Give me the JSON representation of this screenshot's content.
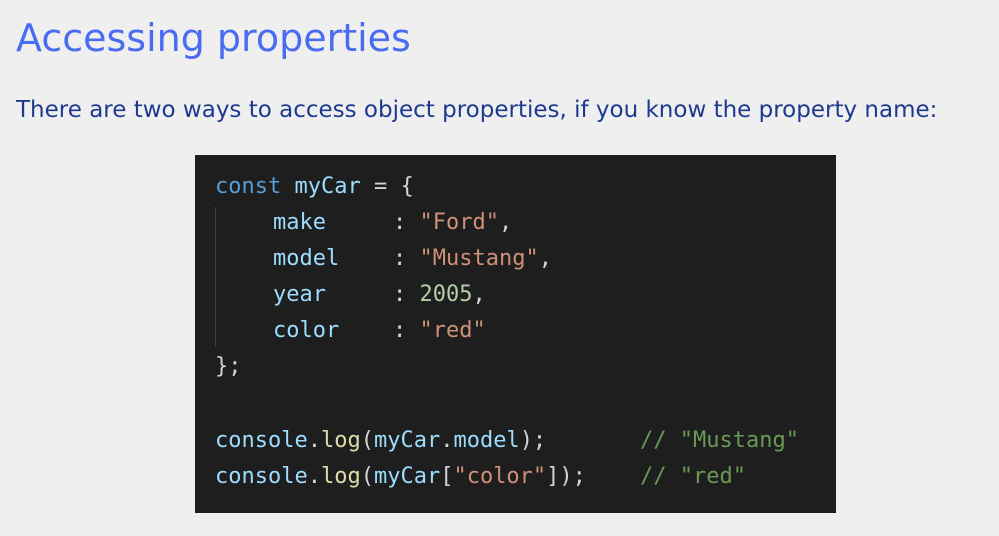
{
  "page": {
    "title": "Accessing properties",
    "intro": "There are two ways to access object properties, if you know the property name:"
  },
  "code": {
    "line1": {
      "keyword": "const",
      "name": "myCar",
      "op": " = {"
    },
    "props": [
      {
        "key": "make",
        "sep": ": ",
        "value": "\"Ford\"",
        "type": "string",
        "trail": ","
      },
      {
        "key": "model",
        "sep": ": ",
        "value": "\"Mustang\"",
        "type": "string",
        "trail": ","
      },
      {
        "key": "year",
        "sep": ": ",
        "value": "2005",
        "type": "number",
        "trail": ","
      },
      {
        "key": "color",
        "sep": ": ",
        "value": "\"red\"",
        "type": "string",
        "trail": ""
      }
    ],
    "close": "};",
    "log1": {
      "obj": "console",
      "dot": ".",
      "fn": "log",
      "open": "(",
      "arg_obj": "myCar",
      "arg_dot": ".",
      "arg_prop": "model",
      "close": ");",
      "comment": "// \"Mustang\""
    },
    "log2": {
      "obj": "console",
      "dot": ".",
      "fn": "log",
      "open": "(",
      "arg_obj": "myCar",
      "bracket_open": "[",
      "arg_key": "\"color\"",
      "bracket_close": "]",
      "close": ");",
      "comment": "// \"red\""
    }
  },
  "colors": {
    "title": "#4a6cf0",
    "intro": "#1d3a8f",
    "code_bg": "#1e1e1e",
    "keyword": "#569cd6",
    "variable": "#9cdcfe",
    "string": "#ce9178",
    "number": "#b5cea8",
    "function": "#dcdcaa",
    "comment": "#6a9955"
  }
}
